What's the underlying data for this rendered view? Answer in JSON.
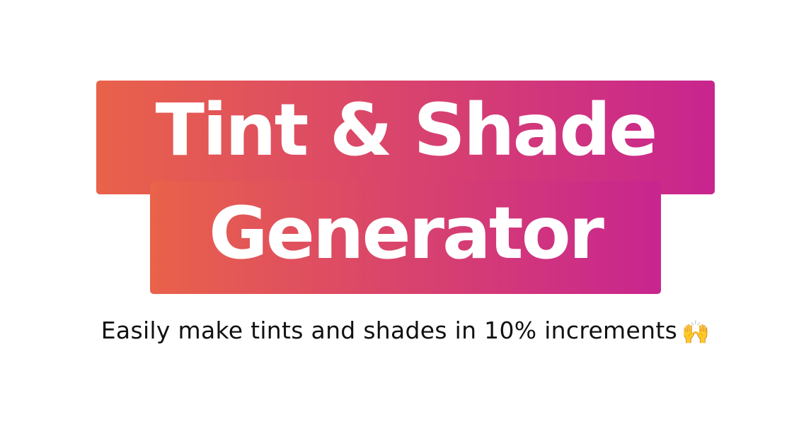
{
  "title": {
    "line1": "Tint & Shade",
    "line2": "Generator"
  },
  "tagline": {
    "text": "Easily make tints and shades in 10% increments",
    "emoji": "🙌"
  },
  "colors": {
    "gradient_start": "#e9624a",
    "gradient_end": "#c8258f",
    "title_text": "#ffffff",
    "body_text": "#111111",
    "background": "#ffffff"
  }
}
